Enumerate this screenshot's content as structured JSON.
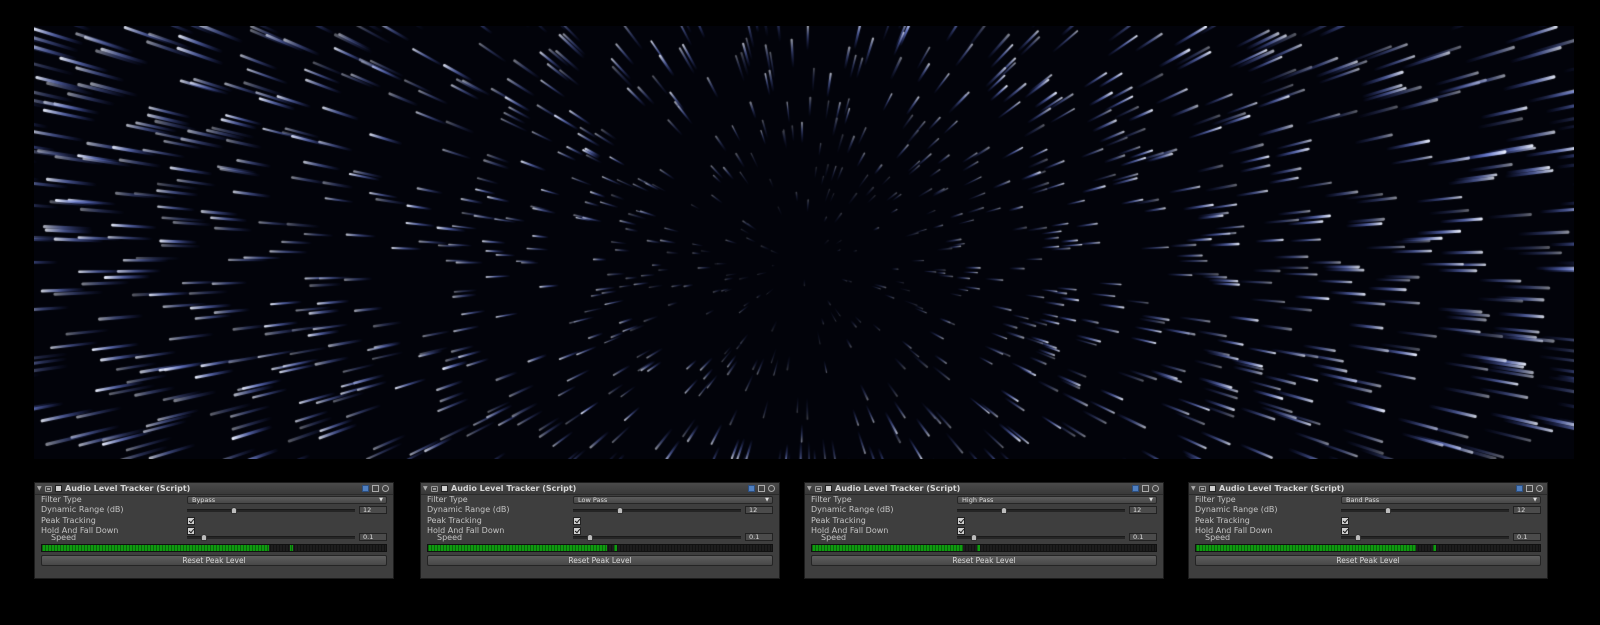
{
  "viewport": {},
  "panels": [
    {
      "title": "Audio Level Tracker (Script)",
      "filter_type_label": "Filter Type",
      "filter_type_value": "Bypass",
      "dynamic_range_label": "Dynamic Range (dB)",
      "dynamic_range_value": "12",
      "dynamic_range_fraction": 0.28,
      "peak_tracking_label": "Peak Tracking",
      "peak_tracking": true,
      "hold_label": "Hold And Fall Down",
      "hold": true,
      "speed_label": "Speed",
      "speed_value": "0.1",
      "speed_fraction": 0.1,
      "meter_level": 0.66,
      "meter_peak": 0.72,
      "reset_label": "Reset Peak Level"
    },
    {
      "title": "Audio Level Tracker (Script)",
      "filter_type_label": "Filter Type",
      "filter_type_value": "Low Pass",
      "dynamic_range_label": "Dynamic Range (dB)",
      "dynamic_range_value": "12",
      "dynamic_range_fraction": 0.28,
      "peak_tracking_label": "Peak Tracking",
      "peak_tracking": true,
      "hold_label": "Hold And Fall Down",
      "hold": true,
      "speed_label": "Speed",
      "speed_value": "0.1",
      "speed_fraction": 0.1,
      "meter_level": 0.52,
      "meter_peak": 0.54,
      "reset_label": "Reset Peak Level"
    },
    {
      "title": "Audio Level Tracker (Script)",
      "filter_type_label": "Filter Type",
      "filter_type_value": "High Pass",
      "dynamic_range_label": "Dynamic Range (dB)",
      "dynamic_range_value": "12",
      "dynamic_range_fraction": 0.28,
      "peak_tracking_label": "Peak Tracking",
      "peak_tracking": true,
      "hold_label": "Hold And Fall Down",
      "hold": true,
      "speed_label": "Speed",
      "speed_value": "0.1",
      "speed_fraction": 0.1,
      "meter_level": 0.44,
      "meter_peak": 0.48,
      "reset_label": "Reset Peak Level"
    },
    {
      "title": "Audio Level Tracker (Script)",
      "filter_type_label": "Filter Type",
      "filter_type_value": "Band Pass",
      "dynamic_range_label": "Dynamic Range (dB)",
      "dynamic_range_value": "12",
      "dynamic_range_fraction": 0.28,
      "peak_tracking_label": "Peak Tracking",
      "peak_tracking": true,
      "hold_label": "Hold And Fall Down",
      "hold": true,
      "speed_label": "Speed",
      "speed_value": "0.1",
      "speed_fraction": 0.1,
      "meter_level": 0.64,
      "meter_peak": 0.69,
      "reset_label": "Reset Peak Level"
    }
  ],
  "icons": {
    "foldout": "triangle-down-icon",
    "component": "script-component-icon",
    "help": "book-icon",
    "preset": "preset-icon",
    "settings": "gear-icon"
  },
  "colors": {
    "meter_green": "#0f9c10",
    "panel_bg": "#3e3e3e",
    "star_color": "#b8c8ff"
  }
}
